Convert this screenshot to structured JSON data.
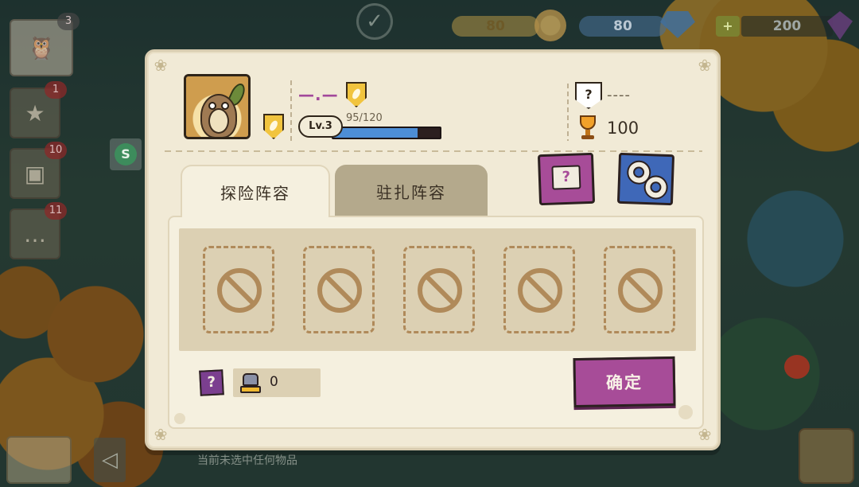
{
  "hud": {
    "coins": "80",
    "gems": "80",
    "plus": "+",
    "crystals": "200"
  },
  "side_menu": {
    "avatar_badge": "3",
    "star_badge": "1",
    "book_badge": "10",
    "chat_badge": "11",
    "s_label": "S"
  },
  "bottom": {
    "status_text": "当前未选中任何物品"
  },
  "profile": {
    "name": "—.—",
    "level_label": "Lv.3",
    "xp_text": "95/120",
    "xp_current": 95,
    "xp_max": 120,
    "title_icon": "?",
    "title_text": "----",
    "trophies": "100"
  },
  "tabs": [
    {
      "label": "探险阵容",
      "active": true
    },
    {
      "label": "驻扎阵容",
      "active": false
    }
  ],
  "buttons": {
    "help_icon_text": "?",
    "confirm_label": "确定"
  },
  "team": {
    "slots": [
      "empty",
      "empty",
      "empty",
      "empty",
      "empty"
    ],
    "power_help_text": "?",
    "power_value": "0"
  },
  "colors": {
    "accent_purple": "#a74c98",
    "accent_blue": "#3f68b8",
    "xp_blue": "#4d8ed6",
    "panel_cream": "#f1ead6"
  }
}
